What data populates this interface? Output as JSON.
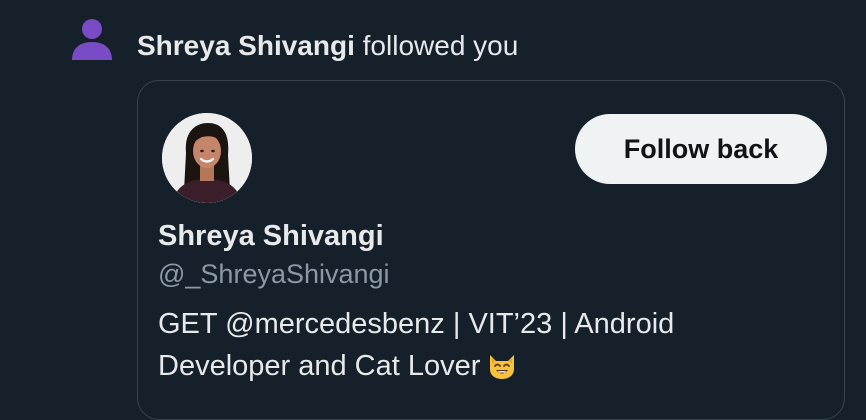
{
  "notification": {
    "actor_name": "Shreya Shivangi",
    "action_text": "followed you",
    "icon": "person-icon",
    "accent_color": "#794bc4"
  },
  "profile_card": {
    "display_name": "Shreya Shivangi",
    "handle": "@_ShreyaShivangi",
    "bio_line1": "GET @mercedesbenz | VIT’23 | Android",
    "bio_line2": "Developer and Cat Lover",
    "bio_emoji": "cat-smile-emoji",
    "follow_back_label": "Follow back",
    "avatar": "profile-photo"
  }
}
